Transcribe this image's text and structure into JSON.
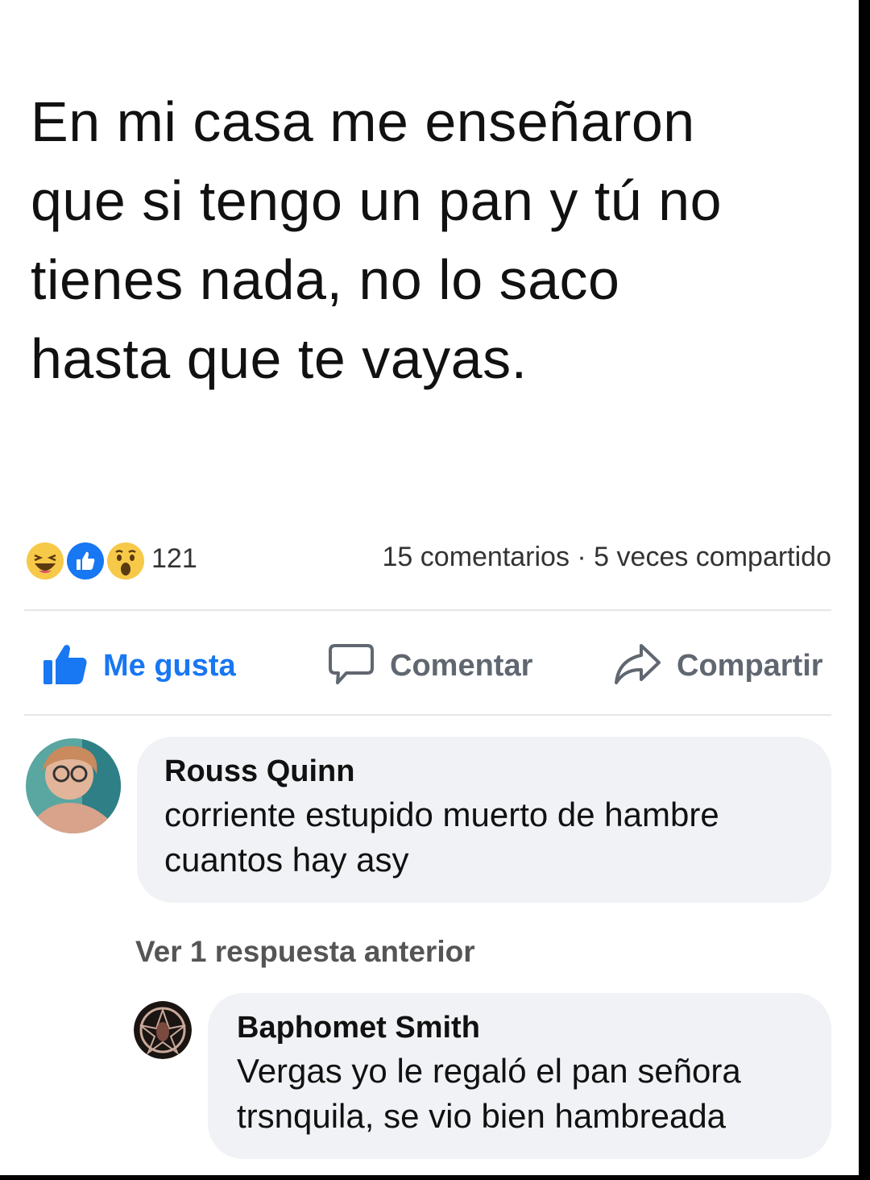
{
  "post": {
    "text": "En mi casa me enseñaron\nque si tengo un pan y tú no\ntienes nada, no lo saco\nhasta que te vayas."
  },
  "stats": {
    "reaction_icons": [
      "haha-icon",
      "like-icon",
      "wow-icon"
    ],
    "reaction_count": "121",
    "comments_shares": "15 comentarios · 5 veces compartido"
  },
  "actions": {
    "like": "Me gusta",
    "comment": "Comentar",
    "share": "Compartir"
  },
  "comments": [
    {
      "author": "Rouss Quinn",
      "text": "corriente estupido muerto de hambre cuantos hay asy"
    },
    {
      "author": "Baphomet Smith",
      "text": "Vergas yo le regaló el pan señora trsnquila, se vio bien hambreada"
    }
  ],
  "view_previous_replies": "Ver 1 respuesta anterior",
  "colors": {
    "brand_blue": "#1877f2",
    "bubble_bg": "#f0f2f5",
    "muted_text": "#606770"
  }
}
